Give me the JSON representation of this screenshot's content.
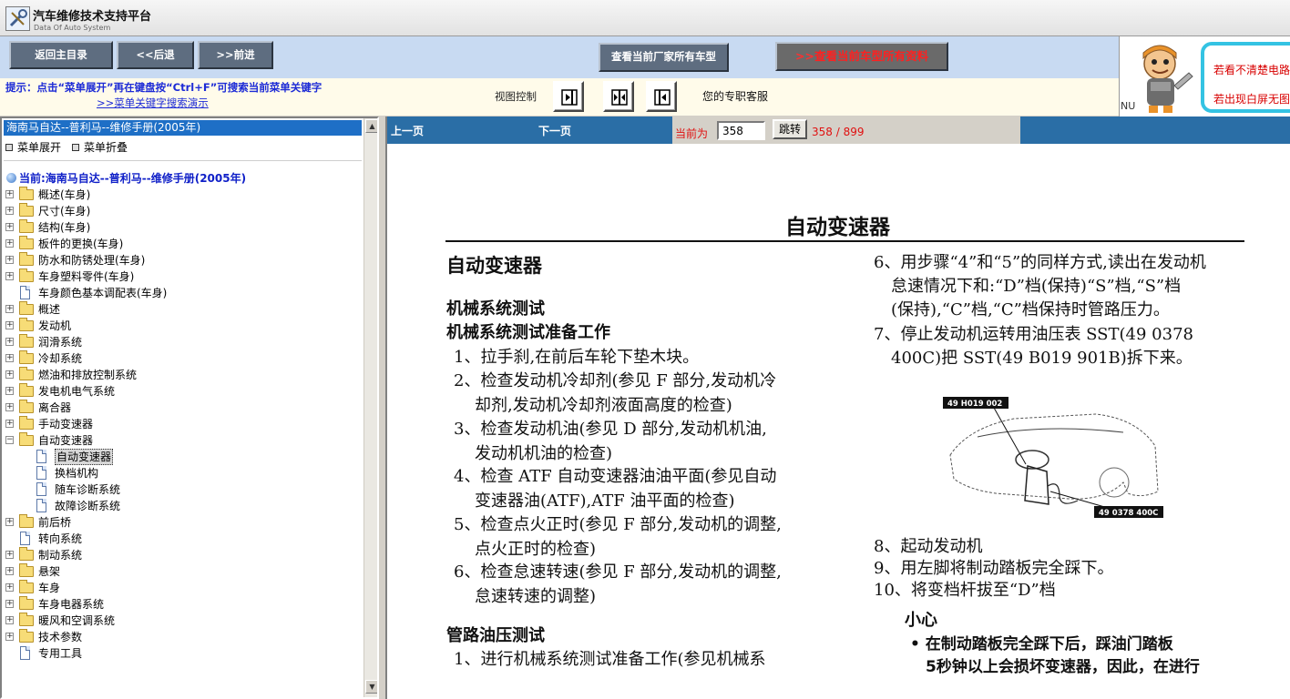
{
  "app": {
    "title": "汽车维修技术支持平台",
    "subtitle": "Data Of Auto System",
    "logo_icon": "wrench-logo-icon"
  },
  "toolbar": {
    "home_label": "返回主目录",
    "back_label": "<<后退",
    "forward_label": ">>前进",
    "all_models_label": "查看当前厂家所有车型",
    "all_docs_label": "查看当前车型所有资料",
    "all_docs_prefix": ">>"
  },
  "hint": {
    "text": "提示：点击“菜单展开”再在键盘按“Ctrl+F”可搜索当前菜单关键字",
    "link": ">>菜单关键字搜索演示"
  },
  "view_control": {
    "label": "视图控制",
    "buttons": [
      "expand-right-icon",
      "split-view-icon",
      "collapse-left-icon"
    ]
  },
  "support": {
    "text": "您的专职客服"
  },
  "ad": {
    "line1": "若看不清楚电路",
    "line2": "若出现白屏无图",
    "nu": "NU",
    "accent": "#34c3e3"
  },
  "sidebar": {
    "manual_title": "海南马自达--普利马--维修手册(2005年)",
    "expand_label": "菜单展开",
    "collapse_label": "菜单折叠",
    "current_label": "当前:海南马自达--普利马--维修手册(2005年)",
    "tree": [
      {
        "label": "概述(车身)",
        "type": "folder",
        "level": 0
      },
      {
        "label": "尺寸(车身)",
        "type": "folder",
        "level": 0
      },
      {
        "label": "结构(车身)",
        "type": "folder",
        "level": 0
      },
      {
        "label": "板件的更换(车身)",
        "type": "folder",
        "level": 0
      },
      {
        "label": "防水和防锈处理(车身)",
        "type": "folder",
        "level": 0
      },
      {
        "label": "车身塑料零件(车身)",
        "type": "folder",
        "level": 0
      },
      {
        "label": "车身颜色基本调配表(车身)",
        "type": "doc",
        "level": 0
      },
      {
        "label": "概述",
        "type": "folder",
        "level": 0
      },
      {
        "label": "发动机",
        "type": "folder",
        "level": 0
      },
      {
        "label": "润滑系统",
        "type": "folder",
        "level": 0
      },
      {
        "label": "冷却系统",
        "type": "folder",
        "level": 0
      },
      {
        "label": "燃油和排放控制系统",
        "type": "folder",
        "level": 0
      },
      {
        "label": "发电机电气系统",
        "type": "folder",
        "level": 0
      },
      {
        "label": "离合器",
        "type": "folder",
        "level": 0
      },
      {
        "label": "手动变速器",
        "type": "folder",
        "level": 0
      },
      {
        "label": "自动变速器",
        "type": "folder-open",
        "level": 0
      },
      {
        "label": "自动变速器",
        "type": "doc",
        "level": 1,
        "selected": true
      },
      {
        "label": "换档机构",
        "type": "doc",
        "level": 1
      },
      {
        "label": "随车诊断系统",
        "type": "doc",
        "level": 1
      },
      {
        "label": "故障诊断系统",
        "type": "doc",
        "level": 1
      },
      {
        "label": "前后桥",
        "type": "folder",
        "level": 0
      },
      {
        "label": "转向系统",
        "type": "doc",
        "level": 0
      },
      {
        "label": "制动系统",
        "type": "folder",
        "level": 0
      },
      {
        "label": "悬架",
        "type": "folder",
        "level": 0
      },
      {
        "label": "车身",
        "type": "folder",
        "level": 0
      },
      {
        "label": "车身电器系统",
        "type": "folder",
        "level": 0
      },
      {
        "label": "暖风和空调系统",
        "type": "folder",
        "level": 0
      },
      {
        "label": "技术参数",
        "type": "folder",
        "level": 0
      },
      {
        "label": "专用工具",
        "type": "doc",
        "level": 0
      }
    ]
  },
  "pager": {
    "prev_label": "上一页",
    "next_label": "下一页",
    "current_label": "当前为",
    "page_value": "358",
    "jump_label": "跳转",
    "count": "358 / 899"
  },
  "page": {
    "header": "自动变速器",
    "left": {
      "title": "自动变速器",
      "h1": "机械系统测试",
      "h2": "机械系统测试准备工作",
      "items": [
        [
          "1、拉手刹,在前后车轮下垫木块。"
        ],
        [
          "2、检查发动机冷却剂(参见 F 部分,发动机冷",
          "却剂,发动机冷却剂液面高度的检查)"
        ],
        [
          "3、检查发动机油(参见 D 部分,发动机机油,",
          "发动机机油的检查)"
        ],
        [
          "4、检查 ATF 自动变速器油油平面(参见自动",
          "变速器油(ATF),ATF 油平面的检查)"
        ],
        [
          "5、检查点火正时(参见 F 部分,发动机的调整,",
          "点火正时的检查)"
        ],
        [
          "6、检查怠速转速(参见 F 部分,发动机的调整,",
          "怠速转速的调整)"
        ]
      ],
      "h3": "管路油压测试",
      "last": "1、进行机械系统测试准备工作(参见机械系"
    },
    "right": {
      "items": [
        [
          "6、用步骤“4”和“5”的同样方式,读出在发动机",
          "怠速情况下和:“D”档(保持)“S”档,“S”档",
          "(保持),“C”档,“C”档保持时管路压力。"
        ],
        [
          "7、停止发动机运转用油压表 SST(49 0378",
          "400C)把 SST(49 B019 901B)拆下来。"
        ]
      ],
      "fig_tag1": "49 H019 002",
      "fig_tag2": "49 0378 400C",
      "steps": [
        "8、起动发动机",
        "9、用左脚将制动踏板完全踩下。",
        "10、将变档杆拔至“D”档"
      ],
      "caution_title": "小心",
      "caution": [
        "• 在制动踏板完全踩下后，踩油门踏板",
        "5秒钟以上会损坏变速器，因此，在进行"
      ]
    }
  }
}
